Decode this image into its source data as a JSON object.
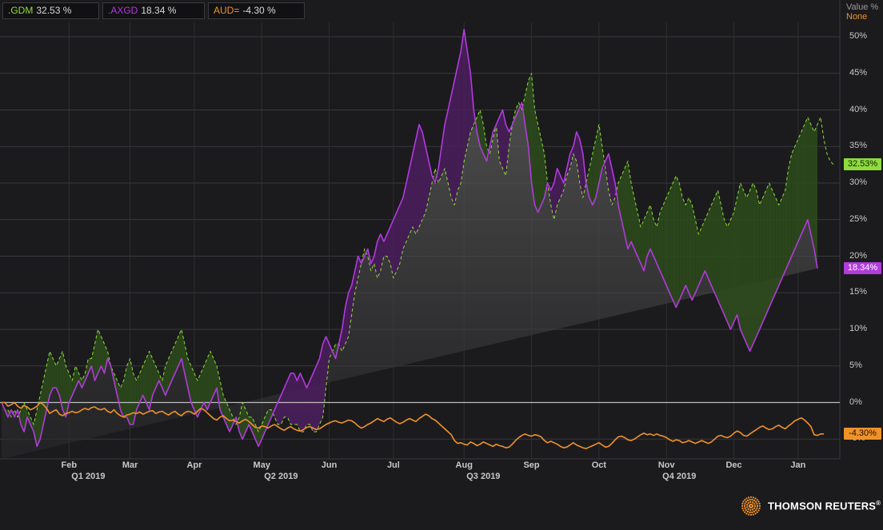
{
  "legend": [
    {
      "symbol": ".GDM",
      "value": "32.53 %",
      "color": "#8fdc3c"
    },
    {
      "symbol": ".AXGD",
      "value": "18.34 %",
      "color": "#b13bdc"
    },
    {
      "symbol": "AUD=",
      "value": "-4.30 %",
      "color": "#f0922b"
    }
  ],
  "units": {
    "line1": "Value %",
    "line2": "None"
  },
  "last_labels": {
    "gdm": "32.53%",
    "axgd": "18.34%",
    "aud": "-4.30%"
  },
  "brand": {
    "name": "THOMSON REUTERS",
    "mark": "®"
  },
  "chart_data": {
    "type": "line",
    "ylabel": "Value %",
    "ylim": [
      -6.5,
      54
    ],
    "y_ticks": [
      "50%",
      "45%",
      "40%",
      "35%",
      "30%",
      "25%",
      "20%",
      "15%",
      "10%",
      "5%",
      "0%",
      "-5%"
    ],
    "y_tick_values": [
      50,
      45,
      40,
      35,
      30,
      25,
      20,
      15,
      10,
      5,
      0,
      -5
    ],
    "x_ticks": [
      "Feb",
      "Mar",
      "Apr",
      "May",
      "Jun",
      "Jul",
      "Aug",
      "Sep",
      "Oct",
      "Nov",
      "Dec",
      "Jan"
    ],
    "x_tick_index": [
      21,
      40,
      60,
      81,
      102,
      122,
      144,
      165,
      186,
      207,
      228,
      248
    ],
    "quarter_labels": [
      "Q1 2019",
      "Q2 2019",
      "Q3 2019",
      "Q4 2019"
    ],
    "quarter_index": [
      27,
      87,
      150,
      211
    ],
    "x_count": 258,
    "grid": true,
    "legend_position": "top-left",
    "series": [
      {
        "name": ".GDM",
        "color": "#8fdc3c",
        "fill": "#2c4a1c",
        "dashed": true,
        "last": 32.53,
        "values": [
          0,
          -1,
          -1,
          -2,
          -1,
          -2,
          -1,
          0,
          -1,
          -2,
          -3,
          -1,
          1,
          3,
          5,
          7,
          6,
          5,
          6,
          7,
          5,
          4,
          3,
          5,
          4,
          3,
          4,
          6,
          6,
          8,
          10,
          9,
          8,
          7,
          5,
          4,
          3,
          2,
          3,
          5,
          6,
          4,
          3,
          4,
          5,
          6,
          7,
          6,
          5,
          4,
          3,
          5,
          6,
          7,
          8,
          9,
          10,
          8,
          6,
          5,
          4,
          3,
          4,
          5,
          6,
          7,
          6,
          5,
          3,
          1,
          0,
          -1,
          -2,
          -3,
          -2,
          0,
          -1,
          -2,
          -2,
          -3,
          -4,
          -3,
          -2,
          -1,
          -1,
          -2,
          -3,
          -3,
          -2,
          -2,
          -3,
          -3,
          -3,
          -4,
          -4,
          -3,
          -3,
          -4,
          -4,
          -3,
          -2,
          2,
          6,
          7,
          8,
          8,
          7,
          8,
          9,
          12,
          15,
          17,
          19,
          21,
          20,
          18,
          19,
          17,
          18,
          20,
          20,
          19,
          17,
          18,
          19,
          21,
          22,
          23,
          24,
          23,
          24,
          25,
          26,
          28,
          30,
          32,
          30,
          31,
          32,
          30,
          28,
          27,
          29,
          30,
          33,
          35,
          37,
          38,
          39,
          40,
          38,
          35,
          34,
          36,
          38,
          33,
          32,
          31,
          35,
          38,
          40,
          41,
          40,
          42,
          44,
          45,
          40,
          38,
          36,
          34,
          30,
          27,
          25,
          27,
          28,
          29,
          31,
          32,
          34,
          33,
          30,
          28,
          30,
          32,
          34,
          36,
          38,
          35,
          32,
          29,
          27,
          28,
          30,
          31,
          32,
          33,
          30,
          28,
          26,
          24,
          25,
          26,
          27,
          25,
          24,
          26,
          27,
          28,
          29,
          30,
          31,
          30,
          28,
          27,
          28,
          27,
          25,
          23,
          24,
          25,
          26,
          27,
          28,
          29,
          27,
          25,
          24,
          25,
          26,
          28,
          30,
          29,
          28,
          29,
          30,
          29,
          27,
          28,
          29,
          30,
          29,
          28,
          27,
          28,
          29,
          32,
          34,
          35,
          36,
          37,
          38,
          39,
          38,
          37,
          38,
          39,
          36,
          34,
          33,
          32.53
        ]
      },
      {
        "name": ".AXGD",
        "color": "#b13bdc",
        "fill": "#4a1e5c",
        "dashed": false,
        "last": 18.34,
        "values": [
          0,
          -1,
          -2,
          -1,
          -2,
          -1,
          -3,
          -4,
          -2,
          -3,
          -4,
          -6,
          -5,
          -3,
          -1,
          1,
          2,
          2,
          1,
          -1,
          -2,
          0,
          1,
          2,
          3,
          2,
          3,
          4,
          5,
          3,
          4,
          5,
          4,
          6,
          5,
          3,
          1,
          -1,
          -2,
          -2,
          -3,
          -3,
          -1,
          0,
          1,
          0,
          -1,
          1,
          2,
          3,
          2,
          1,
          2,
          3,
          4,
          5,
          6,
          4,
          2,
          0,
          -1,
          -2,
          -1,
          0,
          -1,
          0,
          1,
          2,
          -1,
          -2,
          -3,
          -4,
          -3,
          -2,
          -4,
          -5,
          -4,
          -3,
          -4,
          -5,
          -6,
          -5,
          -4,
          -3,
          -2,
          -1,
          0,
          1,
          2,
          3,
          4,
          4,
          3,
          4,
          3,
          2,
          3,
          4,
          5,
          6,
          8,
          9,
          8,
          7,
          6,
          8,
          10,
          13,
          15,
          16,
          18,
          20,
          19,
          20,
          21,
          19,
          20,
          22,
          23,
          22,
          23,
          24,
          25,
          26,
          27,
          28,
          30,
          32,
          34,
          36,
          38,
          37,
          35,
          33,
          31,
          30,
          32,
          35,
          38,
          40,
          42,
          44,
          46,
          48,
          51,
          48,
          45,
          40,
          37,
          35,
          34,
          33,
          35,
          37,
          38,
          39,
          40,
          38,
          37,
          38,
          39,
          40,
          41,
          38,
          35,
          30,
          27,
          26,
          27,
          28,
          30,
          29,
          30,
          32,
          31,
          30,
          32,
          34,
          35,
          37,
          36,
          34,
          30,
          28,
          27,
          28,
          30,
          32,
          33,
          34,
          32,
          30,
          27,
          25,
          23,
          21,
          22,
          21,
          20,
          19,
          18,
          20,
          21,
          20,
          19,
          18,
          17,
          16,
          15,
          14,
          13,
          14,
          15,
          16,
          15,
          14,
          15,
          16,
          17,
          18,
          17,
          16,
          15,
          14,
          13,
          12,
          11,
          10,
          11,
          12,
          10,
          9,
          8,
          7,
          8,
          9,
          10,
          11,
          12,
          13,
          14,
          15,
          16,
          17,
          18,
          19,
          20,
          21,
          22,
          23,
          24,
          25,
          23,
          21,
          18.34
        ]
      },
      {
        "name": "AUD=",
        "color": "#f0922b",
        "fill": null,
        "dashed": false,
        "last": -4.3,
        "values": [
          0,
          0,
          -0.5,
          -0.3,
          0,
          -0.5,
          -0.8,
          -0.4,
          -0.6,
          -1,
          -0.8,
          -0.5,
          0,
          -0.3,
          -0.8,
          -1.5,
          -1.2,
          -1,
          -1.6,
          -1.8,
          -1.5,
          -1.4,
          -1.2,
          -1.4,
          -1.3,
          -1,
          -0.8,
          -1,
          -0.7,
          -0.6,
          -0.9,
          -1,
          -0.8,
          -1.2,
          -1.4,
          -1,
          -1.5,
          -1.8,
          -2,
          -1.7,
          -1.6,
          -1.4,
          -1.5,
          -1.3,
          -1.6,
          -1.4,
          -1.2,
          -1.1,
          -1.5,
          -1.3,
          -1.2,
          -1.5,
          -1.7,
          -1.4,
          -1.2,
          -1.6,
          -1.8,
          -1.4,
          -1.2,
          -1.3,
          -1.6,
          -1.2,
          -0.8,
          -1,
          -1.4,
          -1.8,
          -2.2,
          -2.4,
          -2,
          -1.8,
          -2.2,
          -2.5,
          -2.4,
          -2.6,
          -2.8,
          -2.5,
          -2.3,
          -2.6,
          -3,
          -3.4,
          -3.5,
          -3.2,
          -3.3,
          -3.5,
          -3.2,
          -3,
          -3.3,
          -3.6,
          -3.8,
          -3.5,
          -3.3,
          -3.6,
          -3.8,
          -3.9,
          -3.7,
          -3.4,
          -3.3,
          -3.5,
          -3.7,
          -3.6,
          -3.3,
          -3,
          -2.8,
          -2.6,
          -2.5,
          -2.7,
          -2.8,
          -2.6,
          -2.4,
          -2.5,
          -2.8,
          -3.2,
          -3.5,
          -3.3,
          -3,
          -2.8,
          -2.5,
          -2.2,
          -2.4,
          -2.6,
          -2.3,
          -2.1,
          -2.4,
          -2.7,
          -2.9,
          -2.7,
          -2.4,
          -2.2,
          -2.4,
          -2.6,
          -2.2,
          -1.9,
          -1.6,
          -1.8,
          -2.2,
          -2.4,
          -2.8,
          -3.2,
          -3.6,
          -4,
          -4.4,
          -5.2,
          -5.6,
          -5.5,
          -5.7,
          -5.8,
          -5.4,
          -5.6,
          -5.9,
          -5.7,
          -5.4,
          -5.6,
          -5.8,
          -6,
          -5.7,
          -5.9,
          -6,
          -6.2,
          -6.1,
          -5.7,
          -5.2,
          -4.8,
          -4.5,
          -4.3,
          -4.5,
          -4.6,
          -4.4,
          -4.5,
          -4.7,
          -5.2,
          -5.5,
          -5.3,
          -5.5,
          -5.7,
          -6,
          -6.2,
          -6.1,
          -5.8,
          -5.5,
          -5.8,
          -6,
          -6.2,
          -6.3,
          -6.1,
          -5.9,
          -5.7,
          -5.5,
          -5.8,
          -6.1,
          -6,
          -5.6,
          -5.1,
          -4.7,
          -4.6,
          -4.8,
          -5.1,
          -5.2,
          -5,
          -4.7,
          -4.4,
          -4.2,
          -4.4,
          -4.3,
          -4.5,
          -4.3,
          -4.5,
          -4.6,
          -4.8,
          -5.1,
          -5.3,
          -5.1,
          -5.2,
          -5.5,
          -5.4,
          -5.2,
          -5.4,
          -5.6,
          -5.4,
          -5.2,
          -5.4,
          -5.6,
          -5.4,
          -5,
          -4.6,
          -4.5,
          -4.7,
          -4.8,
          -4.6,
          -4.2,
          -3.9,
          -4.1,
          -4.5,
          -4.6,
          -4.3,
          -4,
          -3.7,
          -3.4,
          -3.2,
          -3.5,
          -3.7,
          -3.6,
          -3.3,
          -3.1,
          -3.4,
          -3.6,
          -3.2,
          -2.9,
          -2.5,
          -2.3,
          -2.1,
          -2.4,
          -2.8,
          -3.3,
          -4.4,
          -4.5,
          -4.3,
          -4.3
        ]
      }
    ]
  }
}
